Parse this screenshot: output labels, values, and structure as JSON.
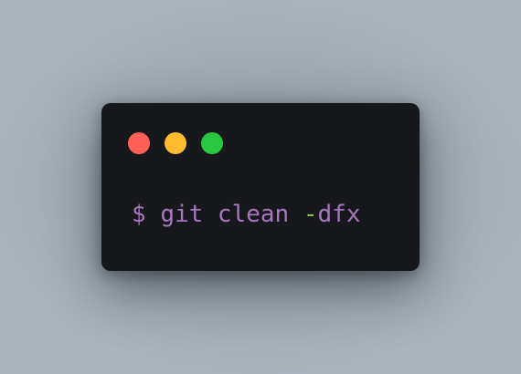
{
  "colors": {
    "close": "#ff5f57",
    "minimize": "#febc2e",
    "maximize": "#28c840",
    "prompt_text": "#a877c2",
    "flag_dash": "#8fbf52",
    "terminal_bg": "#17181b"
  },
  "window_controls": [
    {
      "name": "close-dot",
      "color": "#ff5f57"
    },
    {
      "name": "minimize-dot",
      "color": "#febc2e"
    },
    {
      "name": "maximize-dot",
      "color": "#28c840"
    }
  ],
  "terminal": {
    "prompt": "$",
    "command": "git clean ",
    "flag_dash": "-",
    "flag_letters": "dfx"
  }
}
